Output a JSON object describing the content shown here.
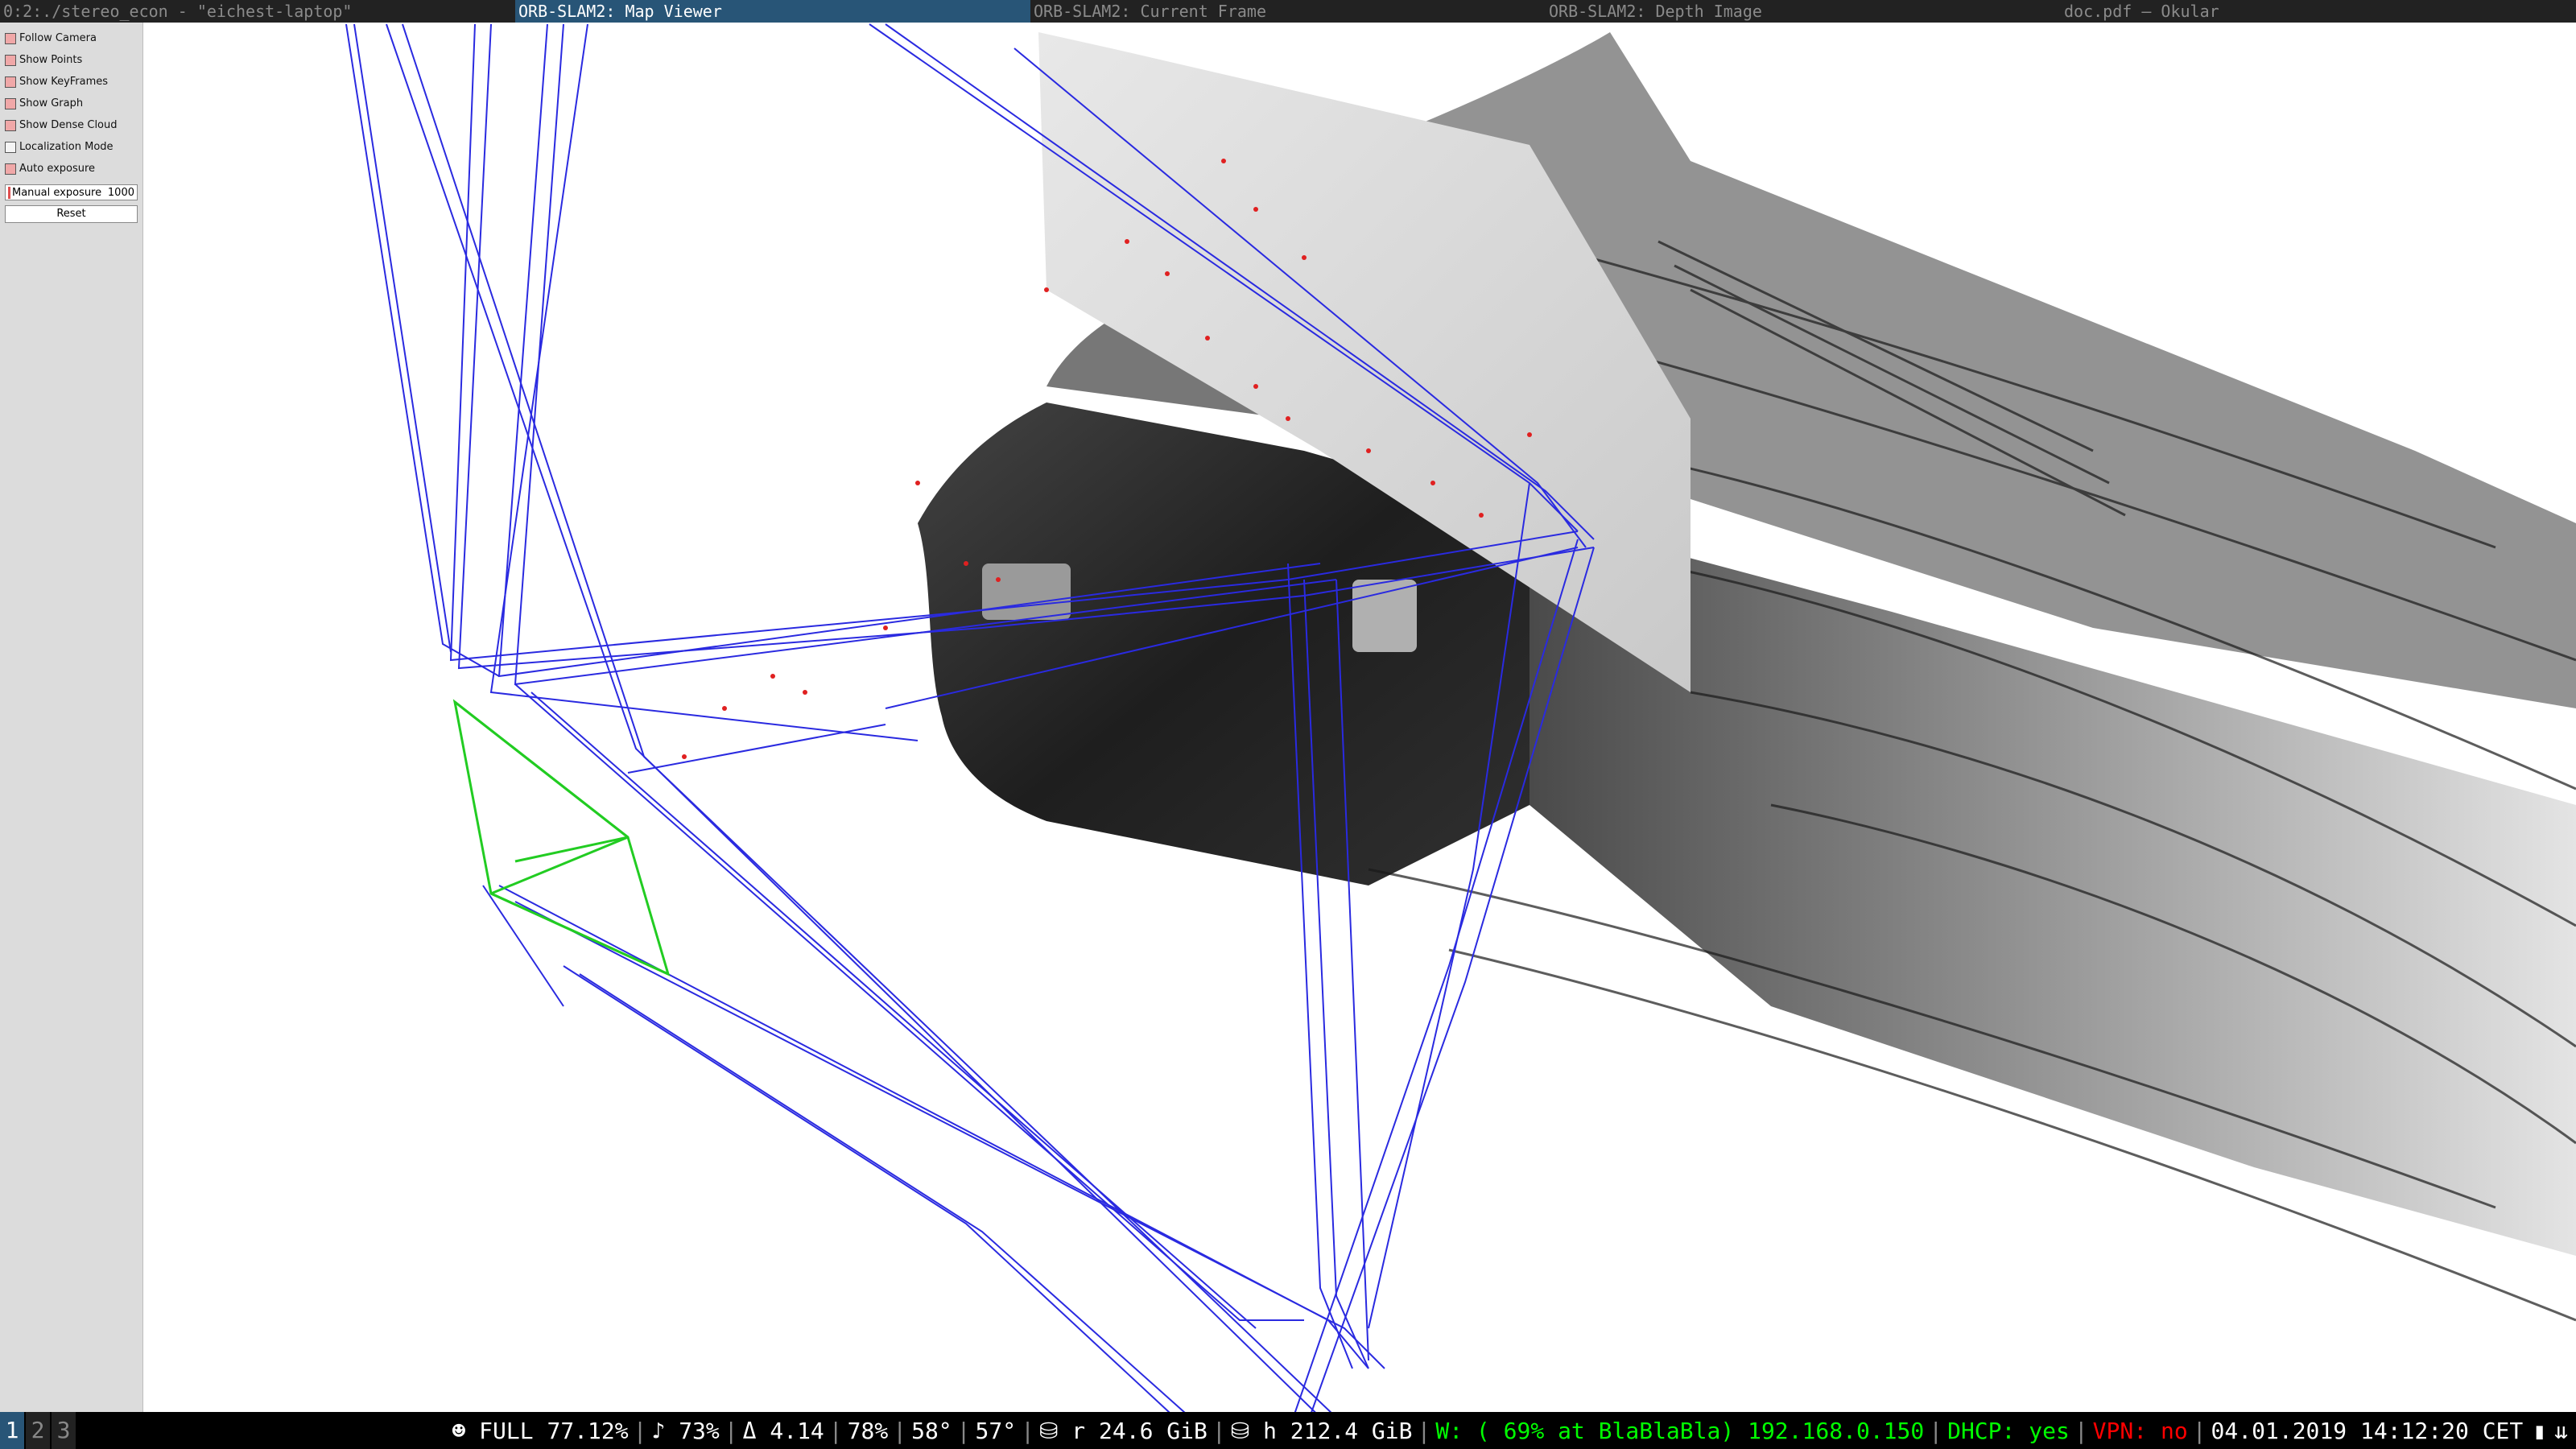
{
  "tabs": [
    {
      "label": "0:2:./stereo_econ - \"eichest-laptop\"",
      "active": false
    },
    {
      "label": "ORB-SLAM2: Map Viewer",
      "active": true
    },
    {
      "label": "ORB-SLAM2: Current Frame",
      "active": false
    },
    {
      "label": "ORB-SLAM2: Depth Image",
      "active": false
    },
    {
      "label": "doc.pdf  — Okular",
      "active": false
    }
  ],
  "panel": {
    "options": [
      {
        "label": "Follow Camera",
        "checked": true
      },
      {
        "label": "Show Points",
        "checked": true
      },
      {
        "label": "Show KeyFrames",
        "checked": true
      },
      {
        "label": "Show Graph",
        "checked": true
      },
      {
        "label": "Show Dense Cloud",
        "checked": true
      },
      {
        "label": "Localization Mode",
        "checked": false
      },
      {
        "label": "Auto exposure",
        "checked": true
      }
    ],
    "manual_exposure_label": "Manual exposure",
    "manual_exposure_value": "1000",
    "reset_label": "Reset"
  },
  "status": {
    "workspaces": [
      "1",
      "2",
      "3"
    ],
    "active_workspace": "1",
    "brightness": "☻ FULL 77.12%",
    "volume": "♪ 73%",
    "load": "Δ 4.14",
    "cpu": "78%",
    "temp1": "58°",
    "temp2": "57°",
    "disk_root": "r 24.6 GiB",
    "disk_home": "h 212.4 GiB",
    "wifi": "W: ( 69% at BlaBlaBla) 192.168.0.150",
    "dhcp": "DHCP: yes",
    "vpn": "VPN: no",
    "datetime": "04.01.2019 14:12:20 CET"
  },
  "colors": {
    "keyframe": "#2a2ae0",
    "current_camera": "#22cc22",
    "map_point": "#e02020",
    "accent": "#285577"
  }
}
